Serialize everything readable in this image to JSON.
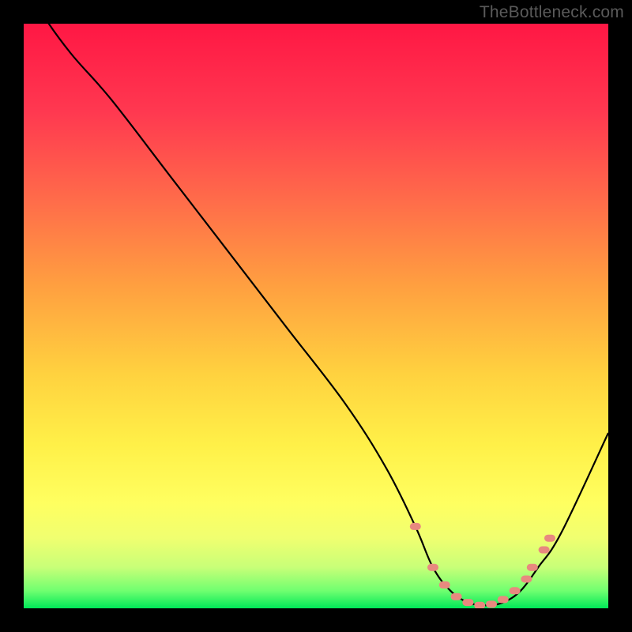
{
  "watermark": "TheBottleneck.com",
  "chart_data": {
    "type": "line",
    "title": "",
    "xlabel": "",
    "ylabel": "",
    "xlim": [
      0,
      100
    ],
    "ylim": [
      0,
      100
    ],
    "series": [
      {
        "name": "bottleneck-curve",
        "x": [
          0,
          3,
          8,
          15,
          25,
          35,
          45,
          55,
          62,
          67,
          70,
          73,
          76,
          79,
          82,
          85,
          88,
          92,
          100
        ],
        "y": [
          108,
          102,
          95,
          87,
          74,
          61,
          48,
          35,
          24,
          14,
          7,
          3,
          1,
          0.5,
          1,
          3,
          7,
          13,
          30
        ]
      }
    ],
    "highlight_points": {
      "name": "optimal-range-markers",
      "color": "#e8897f",
      "x": [
        67,
        70,
        72,
        74,
        76,
        78,
        80,
        82,
        84,
        86,
        87,
        89,
        90
      ],
      "y": [
        14,
        7,
        4,
        2,
        1,
        0.5,
        0.7,
        1.5,
        3,
        5,
        7,
        10,
        12
      ]
    },
    "gradient_stops": [
      {
        "offset": 0,
        "color": "#ff1744"
      },
      {
        "offset": 15,
        "color": "#ff3850"
      },
      {
        "offset": 30,
        "color": "#ff6b4a"
      },
      {
        "offset": 45,
        "color": "#ffa040"
      },
      {
        "offset": 60,
        "color": "#ffd23f"
      },
      {
        "offset": 72,
        "color": "#fff048"
      },
      {
        "offset": 82,
        "color": "#ffff60"
      },
      {
        "offset": 88,
        "color": "#f0ff70"
      },
      {
        "offset": 93,
        "color": "#c8ff78"
      },
      {
        "offset": 97,
        "color": "#70ff70"
      },
      {
        "offset": 100,
        "color": "#00e858"
      }
    ]
  }
}
